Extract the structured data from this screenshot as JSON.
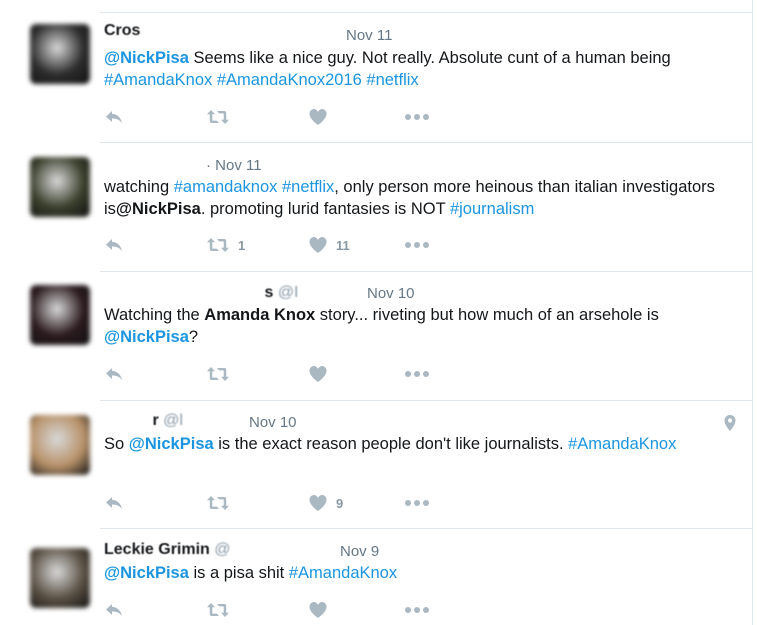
{
  "tweets": [
    {
      "name": "Cros",
      "handle": "",
      "time": "Nov 11",
      "avatar_color": "#2c2c2c",
      "segments": [
        {
          "text": "@NickPisa",
          "style": "mention"
        },
        {
          "text": " Seems like a nice guy. Not really. Absolute cunt of a human being ",
          "style": "plain"
        },
        {
          "text": "#AmandaKnox",
          "style": "link"
        },
        {
          "text": " ",
          "style": "plain"
        },
        {
          "text": "#AmandaKnox2016",
          "style": "link"
        },
        {
          "text": " ",
          "style": "plain"
        },
        {
          "text": "#netflix",
          "style": "link"
        }
      ],
      "retweets": "",
      "likes": ""
    },
    {
      "name": "",
      "handle": "",
      "time": "· Nov 11",
      "avatar_color": "#3a3f2c",
      "segments": [
        {
          "text": "watching ",
          "style": "plain"
        },
        {
          "text": "#amandaknox",
          "style": "link"
        },
        {
          "text": " ",
          "style": "plain"
        },
        {
          "text": "#netflix",
          "style": "link"
        },
        {
          "text": ", only person more heinous than italian investigators is",
          "style": "plain"
        },
        {
          "text": "@NickPisa",
          "style": "bold"
        },
        {
          "text": ". promoting lurid fantasies is NOT ",
          "style": "plain"
        },
        {
          "text": "#journalism",
          "style": "link"
        }
      ],
      "retweets": "1",
      "likes": "11"
    },
    {
      "name": "s",
      "handle": "@I",
      "time": "Nov 10",
      "avatar_color": "#2a1a1e",
      "segments": [
        {
          "text": "Watching the ",
          "style": "plain"
        },
        {
          "text": "Amanda Knox",
          "style": "bold"
        },
        {
          "text": " story... riveting but how much of an arsehole is ",
          "style": "plain"
        },
        {
          "text": "@NickPisa",
          "style": "mention"
        },
        {
          "text": "?",
          "style": "plain"
        }
      ],
      "retweets": "",
      "likes": ""
    },
    {
      "name": "r",
      "handle": "@l",
      "time": "Nov 10",
      "avatar_color": "#b8926a",
      "segments": [
        {
          "text": "So ",
          "style": "plain"
        },
        {
          "text": "@NickPisa",
          "style": "mention"
        },
        {
          "text": " is the exact reason people don't like journalists. ",
          "style": "plain"
        },
        {
          "text": "#AmandaKnox",
          "style": "link"
        }
      ],
      "retweets": "",
      "likes": "9",
      "has_location": true
    },
    {
      "name": "Leckie Grimin",
      "handle": "@",
      "time": "Nov 9",
      "avatar_color": "#5a5044",
      "segments": [
        {
          "text": "@NickPisa",
          "style": "mention"
        },
        {
          "text": " is a pisa shit ",
          "style": "plain"
        },
        {
          "text": "#AmandaKnox",
          "style": "link"
        }
      ],
      "retweets": "",
      "likes": ""
    }
  ],
  "icons": {
    "reply": "reply-icon",
    "retweet": "retweet-icon",
    "like": "heart-icon",
    "more": "more-icon",
    "location": "location-pin-icon"
  },
  "colors": {
    "link": "#1b95e0",
    "icon": "#aab8c2",
    "divider": "#e1e8ed"
  }
}
